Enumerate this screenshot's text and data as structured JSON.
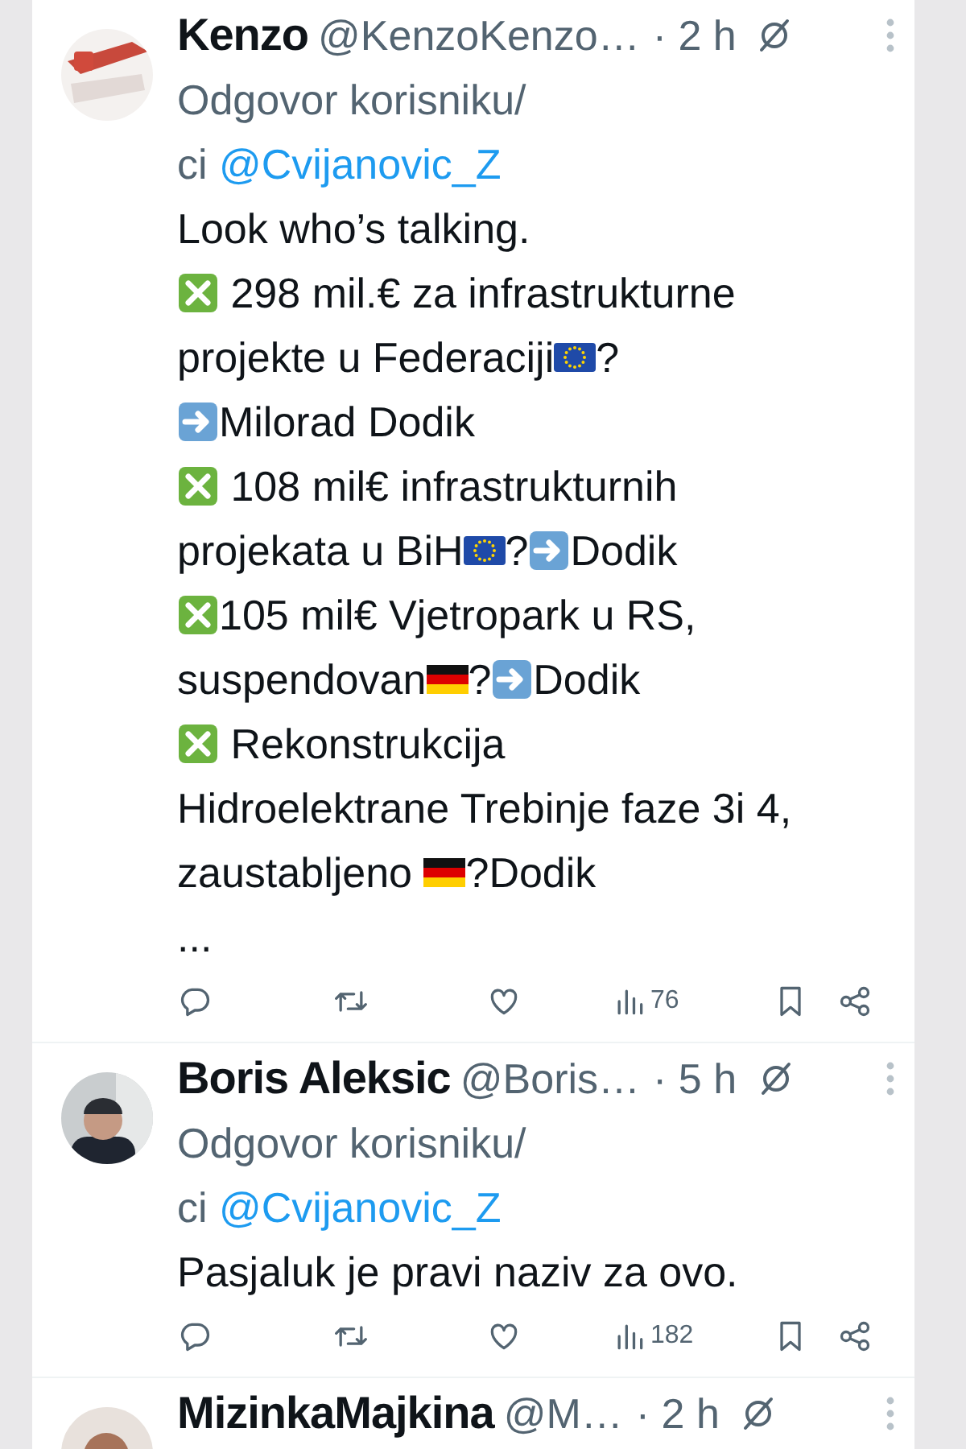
{
  "tweets": [
    {
      "author": "Kenzo",
      "handle": "@KenzoKenzo…",
      "time": "· 2 h",
      "avatar": {
        "kind": "picture"
      },
      "reply_lines": [
        [
          {
            "kind": "text",
            "text": "Odgovor korisniku/"
          }
        ],
        [
          {
            "kind": "text",
            "text": "ci "
          },
          {
            "kind": "mention",
            "text": "@Cvijanovic_Z"
          }
        ]
      ],
      "body": [
        [
          {
            "kind": "text",
            "text": "Look who’s talking."
          }
        ],
        [
          {
            "kind": "cross-mark"
          },
          {
            "kind": "text",
            "text": " 298 mil.€ za infrastrukturne"
          }
        ],
        [
          {
            "kind": "text",
            "text": "projekte u Federaciji"
          },
          {
            "kind": "eu-flag"
          },
          {
            "kind": "text",
            "text": "?"
          }
        ],
        [
          {
            "kind": "arrow"
          },
          {
            "kind": "text",
            "text": "Milorad Dodik"
          }
        ],
        [
          {
            "kind": "cross-mark"
          },
          {
            "kind": "text",
            "text": " 108 mil€ infrastrukturnih"
          }
        ],
        [
          {
            "kind": "text",
            "text": "projekata u BiH"
          },
          {
            "kind": "eu-flag"
          },
          {
            "kind": "text",
            "text": "?"
          },
          {
            "kind": "arrow"
          },
          {
            "kind": "text",
            "text": "Dodik"
          }
        ],
        [
          {
            "kind": "cross-mark"
          },
          {
            "kind": "text",
            "text": "105 mil€ Vjetropark u RS,"
          }
        ],
        [
          {
            "kind": "text",
            "text": "suspendovan"
          },
          {
            "kind": "de-flag"
          },
          {
            "kind": "text",
            "text": "?"
          },
          {
            "kind": "arrow"
          },
          {
            "kind": "text",
            "text": "Dodik"
          }
        ],
        [
          {
            "kind": "cross-mark"
          },
          {
            "kind": "text",
            "text": " Rekonstrukcija"
          }
        ],
        [
          {
            "kind": "text",
            "text": "Hidroelektrane Trebinje faze 3i 4,"
          }
        ],
        [
          {
            "kind": "text",
            "text": "zaustabljeno "
          },
          {
            "kind": "de-flag"
          },
          {
            "kind": "text",
            "text": "?Dodik"
          }
        ],
        [
          {
            "kind": "text",
            "text": "..."
          }
        ]
      ],
      "views": "76"
    },
    {
      "author": "Boris Aleksic",
      "handle": "@Boris…",
      "time": "· 5 h",
      "avatar": {
        "kind": "picture"
      },
      "reply_lines": [
        [
          {
            "kind": "text",
            "text": "Odgovor korisniku/"
          }
        ],
        [
          {
            "kind": "text",
            "text": "ci "
          },
          {
            "kind": "mention",
            "text": "@Cvijanovic_Z"
          }
        ]
      ],
      "body": [
        [
          {
            "kind": "text",
            "text": "Pasjaluk je pravi naziv za ovo."
          }
        ]
      ],
      "views": "182"
    },
    {
      "author": "MizinkaMajkina",
      "handle": "@M…",
      "time": "· 2 h",
      "avatar": {
        "kind": "picture"
      }
    }
  ]
}
